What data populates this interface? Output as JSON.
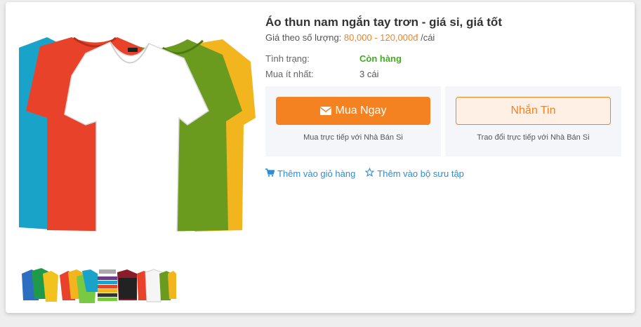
{
  "product": {
    "title": "Áo thun nam ngắn tay trơn - giá si, giá tốt",
    "price_prefix": "Giá theo số lượng:",
    "price_range": "80,000 - 120,000đ",
    "price_unit": "/cái"
  },
  "details": {
    "status_label": "Tình trạng:",
    "status_value": "Còn hàng",
    "min_label": "Mua ít nhất:",
    "min_value": "3 cái"
  },
  "actions": {
    "buy_label": "Mua Ngay",
    "buy_sub": "Mua trực tiếp với Nhà Bán Si",
    "message_label": "Nhắn Tin",
    "message_sub": "Trao đổi trực tiếp với Nhà Bán Si"
  },
  "links": {
    "cart": "Thêm vào giỏ hàng",
    "collection": "Thêm vào bộ sưu tập"
  },
  "colors": {
    "accent": "#f58220",
    "link": "#2a8fd6",
    "in_stock": "#3db01c",
    "shirts": [
      "#1aa3c9",
      "#e8432a",
      "#ffffff",
      "#6a9b1e",
      "#f2b51e"
    ]
  },
  "icons": [
    "envelope-icon",
    "cart-icon",
    "star-outline-icon"
  ]
}
